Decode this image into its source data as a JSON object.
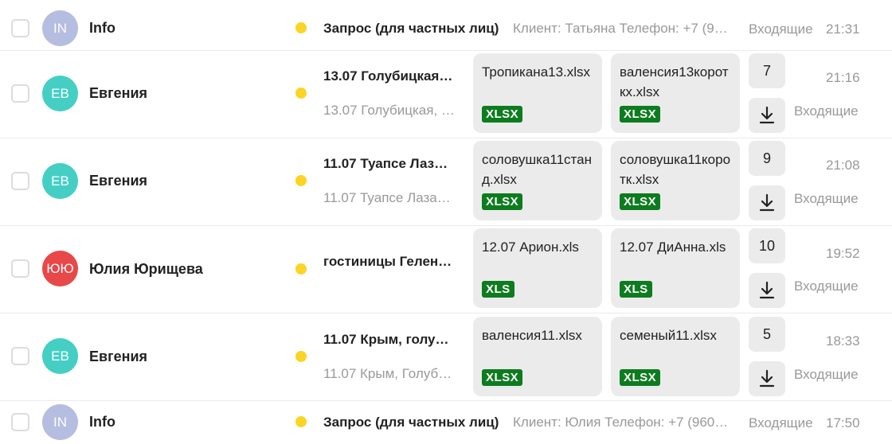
{
  "colors": {
    "unread_dot": "#fcd424",
    "badge_green": "#0d7c1f",
    "avatar_in": "#b5bde0",
    "avatar_eb": "#45cfc4",
    "avatar_yuyu": "#e84848"
  },
  "messages": [
    {
      "checkbox": "unchecked",
      "avatar": "IN",
      "sender": "Info",
      "subject": "Запрос (для частных лиц)",
      "snippet": "Клиент: Татьяна Телефон: +7 (9…",
      "folder": "Входящие",
      "time": "21:31"
    },
    {
      "checkbox": "unchecked",
      "avatar": "ЕВ",
      "sender": "Евгения",
      "subject": "13.07 Голубицкая…",
      "snippet": "13.07 Голубицкая, …",
      "attachments": [
        {
          "name": "Тропикана13.xlsx",
          "type": "XLSX"
        },
        {
          "name": "валенсия13короткх.xlsx",
          "type": "XLSX"
        }
      ],
      "attachment_count": "7",
      "download_icon": "download-icon",
      "folder": "Входящие",
      "time": "21:16"
    },
    {
      "checkbox": "unchecked",
      "avatar": "ЕВ",
      "sender": "Евгения",
      "subject": "11.07 Туапсе Лаз…",
      "snippet": "11.07 Туапсе Лаза…",
      "attachments": [
        {
          "name": "соловушка11станд.xlsx",
          "type": "XLSX"
        },
        {
          "name": "соловушка11коротк.xlsx",
          "type": "XLSX"
        }
      ],
      "attachment_count": "9",
      "download_icon": "download-icon",
      "folder": "Входящие",
      "time": "21:08"
    },
    {
      "checkbox": "unchecked",
      "avatar": "ЮЮ",
      "sender": "Юлия Юрищева",
      "subject": "гостиницы Гелен…",
      "snippet": "",
      "attachments": [
        {
          "name": "12.07 Арион.xls",
          "type": "XLS"
        },
        {
          "name": "12.07 ДиАнна.xls",
          "type": "XLS"
        }
      ],
      "attachment_count": "10",
      "download_icon": "download-icon",
      "folder": "Входящие",
      "time": "19:52"
    },
    {
      "checkbox": "unchecked",
      "avatar": "ЕВ",
      "sender": "Евгения",
      "subject": "11.07 Крым, голу…",
      "snippet": "11.07 Крым, Голуб…",
      "attachments": [
        {
          "name": "валенсия11.xlsx",
          "type": "XLSX"
        },
        {
          "name": "семеный11.xlsx",
          "type": "XLSX"
        }
      ],
      "attachment_count": "5",
      "download_icon": "download-icon",
      "folder": "Входящие",
      "time": "18:33"
    },
    {
      "checkbox": "unchecked",
      "avatar": "IN",
      "sender": "Info",
      "subject": "Запрос (для частных лиц)",
      "snippet": "Клиент: Юлия Телефон: +7 (960…",
      "folder": "Входящие",
      "time": "17:50"
    }
  ]
}
